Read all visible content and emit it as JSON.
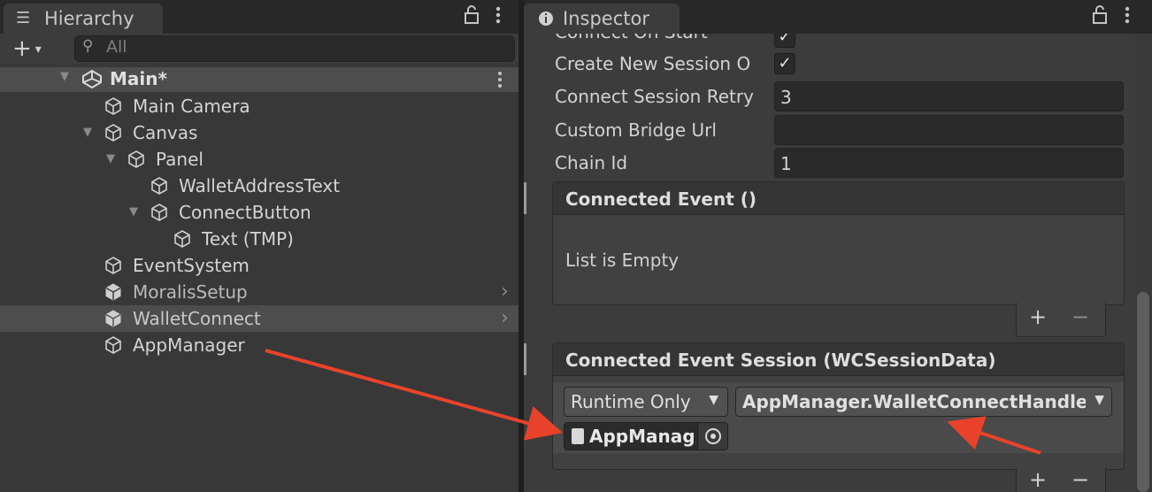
{
  "hierarchy": {
    "tab_title": "Hierarchy",
    "search_placeholder": "All",
    "scene": "Main*",
    "items": [
      {
        "label": "Main Camera"
      },
      {
        "label": "Canvas"
      },
      {
        "label": "Panel"
      },
      {
        "label": "WalletAddressText"
      },
      {
        "label": "ConnectButton"
      },
      {
        "label": "Text (TMP)"
      },
      {
        "label": "EventSystem"
      },
      {
        "label": "MoralisSetup"
      },
      {
        "label": "WalletConnect"
      },
      {
        "label": "AppManager"
      }
    ]
  },
  "inspector": {
    "tab_title": "Inspector",
    "partial_label": "Connect On Start",
    "fields": [
      {
        "label": "Create New Session O",
        "value": ""
      },
      {
        "label": "Connect Session Retry",
        "value": "3"
      },
      {
        "label": "Custom Bridge Url",
        "value": ""
      },
      {
        "label": "Chain Id",
        "value": "1"
      }
    ],
    "connected_event": {
      "title": "Connected Event ()",
      "empty_text": "List is Empty"
    },
    "connected_event_session": {
      "title": "Connected Event Session (WCSessionData)",
      "runtime": "Runtime Only",
      "function": "AppManager.WalletConnectHandler",
      "object": "AppManag"
    },
    "plus": "+",
    "minus": "−"
  },
  "colors": {
    "arrow": "#e8432a",
    "panel_bg": "#383838",
    "inspector_bg": "#3c3c3c",
    "selected_row": "#4d4d4d"
  }
}
